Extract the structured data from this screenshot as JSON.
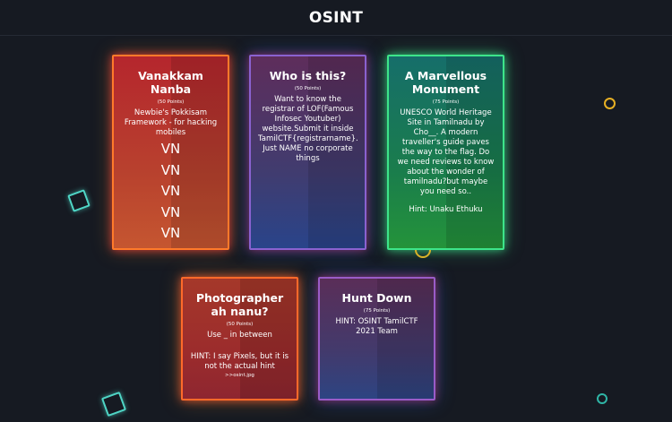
{
  "header": {
    "title": "OSINT"
  },
  "challenges": [
    {
      "title": "Vanakkam Nanba",
      "points": "(50 Points)",
      "description": "Newbie's Pokkisam Framework - for hacking mobiles",
      "vn_lines": [
        "VN",
        "VN",
        "VN",
        "VN",
        "VN"
      ]
    },
    {
      "title": "Who is this?",
      "points": "(50 Points)",
      "description": "Want to know the registrar of LOF(Famous Infosec Youtuber) website.Submit it inside TamilCTF{registrarname}. Just NAME no corporate things"
    },
    {
      "title": "A Marvellous Monument",
      "points": "(75 Points)",
      "description": "UNESCO World Heritage Site in Tamilnadu by Cho__. A modern traveller's guide paves the way to the flag. Do we need reviews to know about the wonder of tamilnadu?but maybe you need so..",
      "hint": "Hint: Unaku Ethuku"
    },
    {
      "title": "Photographer ah nanu?",
      "points": "(50 Points)",
      "description": "Use _ in between",
      "hint": "HINT: I say Pixels, but it is not the actual hint",
      "file": ">>osint.jpg"
    },
    {
      "title": "Hunt Down",
      "points": "(75 Points)",
      "description": "HINT: OSINT TamilCTF 2021 Team"
    }
  ],
  "colors": {
    "background": "#161a22",
    "card1_glow": "#ff7a2a",
    "card2_glow": "#8a62d0",
    "card3_glow": "#3de58a",
    "card4_glow": "#ff6a2a",
    "card5_glow": "#9a5cc8",
    "decoration_teal": "#4fd6c6",
    "decoration_gold": "#e7b024"
  }
}
